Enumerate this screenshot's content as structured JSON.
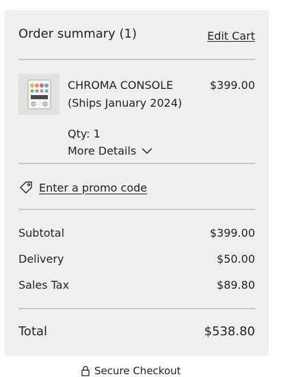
{
  "summary": {
    "title": "Order summary (1)",
    "edit_cart_label": "Edit Cart"
  },
  "item": {
    "name_line1": "CHROMA CONSOLE",
    "name_line2": "(Ships January 2024)",
    "price": "$399.00",
    "qty_label": "Qty: 1",
    "more_details_label": "More Details"
  },
  "promo": {
    "label": "Enter a promo code"
  },
  "totals": {
    "subtotal_label": "Subtotal",
    "subtotal_value": "$399.00",
    "delivery_label": "Delivery",
    "delivery_value": "$50.00",
    "tax_label": "Sales Tax",
    "tax_value": "$89.80",
    "total_label": "Total",
    "total_value": "$538.80"
  },
  "footer": {
    "secure_label": "Secure Checkout"
  },
  "icons": {
    "promo": "tag-icon",
    "more_details": "chevron-down-icon",
    "secure": "lock-icon"
  },
  "colors": {
    "card_background": "#efefef",
    "divider": "#c8c8c8",
    "text": "#222222"
  }
}
